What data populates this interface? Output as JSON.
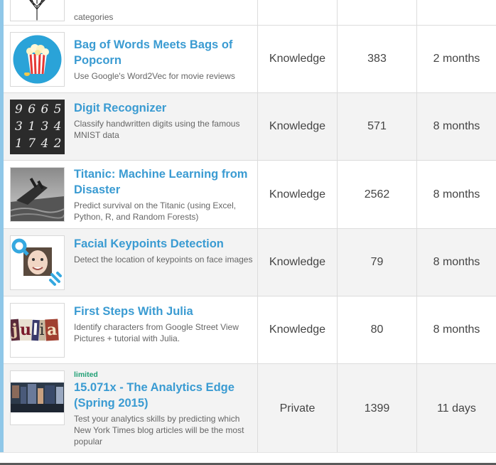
{
  "competitions": [
    {
      "title": "",
      "description": "categories",
      "badge": "",
      "category": "",
      "teams": "",
      "deadline": "",
      "icon": "tree-thumbnail"
    },
    {
      "title": "Bag of Words Meets Bags of Popcorn",
      "description": "Use Google's Word2Vec for movie reviews",
      "badge": "",
      "category": "Knowledge",
      "teams": "383",
      "deadline": "2 months",
      "icon": "popcorn-thumbnail"
    },
    {
      "title": "Digit Recognizer",
      "description": "Classify handwritten digits using the famous MNIST data",
      "badge": "",
      "category": "Knowledge",
      "teams": "571",
      "deadline": "8 months",
      "icon": "digits-thumbnail",
      "digits": [
        "9 6 6 5",
        "3 1 3 4",
        "1 7 4 2"
      ]
    },
    {
      "title": "Titanic: Machine Learning from Disaster",
      "description": "Predict survival on the Titanic (using Excel, Python, R, and Random Forests)",
      "badge": "",
      "category": "Knowledge",
      "teams": "2562",
      "deadline": "8 months",
      "icon": "titanic-thumbnail"
    },
    {
      "title": "Facial Keypoints Detection",
      "description": "Detect the location of keypoints on face images",
      "badge": "",
      "category": "Knowledge",
      "teams": "79",
      "deadline": "8 months",
      "icon": "face-thumbnail"
    },
    {
      "title": "First Steps With Julia",
      "description": "Identify characters from Google Street View Pictures + tutorial with Julia.",
      "badge": "",
      "category": "Knowledge",
      "teams": "80",
      "deadline": "8 months",
      "icon": "julia-thumbnail",
      "thumb_text": "julia"
    },
    {
      "title": "15.071x - The Analytics Edge (Spring 2015)",
      "description": "Test your analytics skills by predicting which New York Times blog articles will be the most popular",
      "badge": "limited",
      "category": "Private",
      "teams": "1399",
      "deadline": "11 days",
      "icon": "analytics-thumbnail"
    }
  ],
  "colors": {
    "title": "#3a9bd2",
    "badge": "#20a075",
    "accent": "#8fc7e8"
  }
}
